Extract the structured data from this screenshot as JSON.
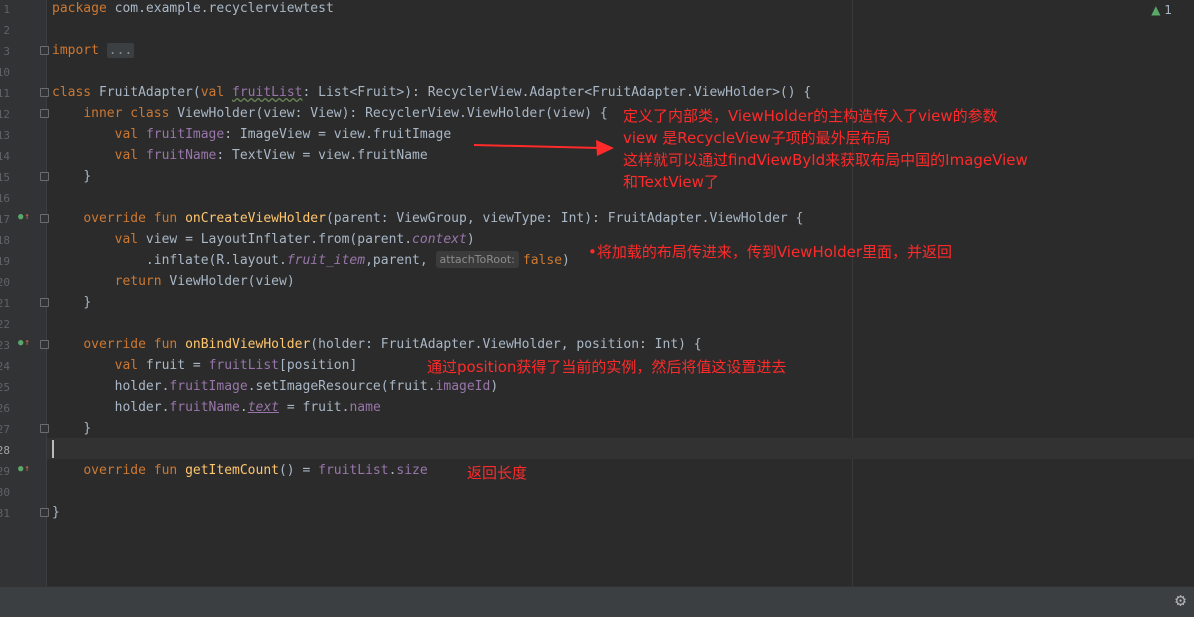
{
  "editor": {
    "line_numbers": [
      "1",
      "2",
      "3",
      "10",
      "11",
      "12",
      "13",
      "14",
      "15",
      "16",
      "17",
      "18",
      "19",
      "20",
      "21",
      "22",
      "23",
      "24",
      "25",
      "26",
      "27",
      "28",
      "29",
      "30",
      "31"
    ],
    "inspection": {
      "icon": "warning-icon",
      "count": "1"
    },
    "lines": {
      "l1": {
        "kw": "package",
        "rest": " com.example.recyclerviewtest"
      },
      "l3": {
        "kw": "import",
        "folded": "..."
      },
      "l11": {
        "kw1": "class",
        "name": " FruitAdapter(",
        "kw2": "val",
        "param": "fruitList",
        "rest": ": List<Fruit>): RecyclerView.Adapter<FruitAdapter.ViewHolder>() {"
      },
      "l12": {
        "kw": "inner class",
        "rest": " ViewHolder(view: View): RecyclerView.ViewHolder(view) {"
      },
      "l13": {
        "kw": "val",
        "prop": "fruitImage",
        "rest": ": ImageView = view.fruitImage"
      },
      "l14": {
        "kw": "val",
        "prop": "fruitName",
        "rest": ": TextView = view.fruitName"
      },
      "l15": {
        "text": "}"
      },
      "l17": {
        "kw": "override fun",
        "fn": "onCreateViewHolder",
        "rest": "(parent: ViewGroup, viewType: Int): FruitAdapter.ViewHolder {"
      },
      "l18": {
        "kw": "val",
        "mid": " view = LayoutInflater.from(parent.",
        "it": "context",
        "end": ")"
      },
      "l19": {
        "a": ".inflate(R.layout.",
        "it": "fruit_item",
        "b": ",parent,",
        "hint": "attachToRoot:",
        "kw": "false",
        "c": ")"
      },
      "l20": {
        "kw": "return",
        "rest": " ViewHolder(view)"
      },
      "l21": {
        "text": "}"
      },
      "l23": {
        "kw": "override fun",
        "fn": "onBindViewHolder",
        "rest": "(holder: FruitAdapter.ViewHolder, position: Int) {"
      },
      "l24": {
        "kw": "val",
        "mid": " fruit = ",
        "prop": "fruitList",
        "end": "[position]"
      },
      "l25": {
        "a": "holder.",
        "prop": "fruitImage",
        "b": ".setImageResource(fruit.",
        "prop2": "imageId",
        "c": ")"
      },
      "l26": {
        "a": "holder.",
        "prop": "fruitName",
        "b": ".",
        "it": "text",
        "c": " = fruit.",
        "prop2": "name"
      },
      "l27": {
        "text": "}"
      },
      "l29": {
        "kw": "override fun",
        "fn": "getItemCount",
        "mid": "() = ",
        "prop": "fruitList",
        "b": ".",
        "prop2": "size"
      },
      "l31": {
        "text": "}"
      }
    }
  },
  "annotations": {
    "a1": "定义了内部类，ViewHolder的主构造传入了view的参数",
    "a2": "view 是RecycleView子项的最外层布局",
    "a3": "这样就可以通过findViewById来获取布局中国的ImageView",
    "a4": "和TextView了",
    "a5": "•将加载的布局传进来，传到ViewHolder里面，并返回",
    "a6": "通过position获得了当前的实例，然后将值这设置进去",
    "a7": "返回长度"
  },
  "colors": {
    "background": "#2b2b2b",
    "keyword": "#cc7832",
    "function": "#ffc66d",
    "property": "#9876aa",
    "annotation": "#ff2a2a"
  },
  "status_bar": {
    "settings_icon": "gear-icon"
  }
}
